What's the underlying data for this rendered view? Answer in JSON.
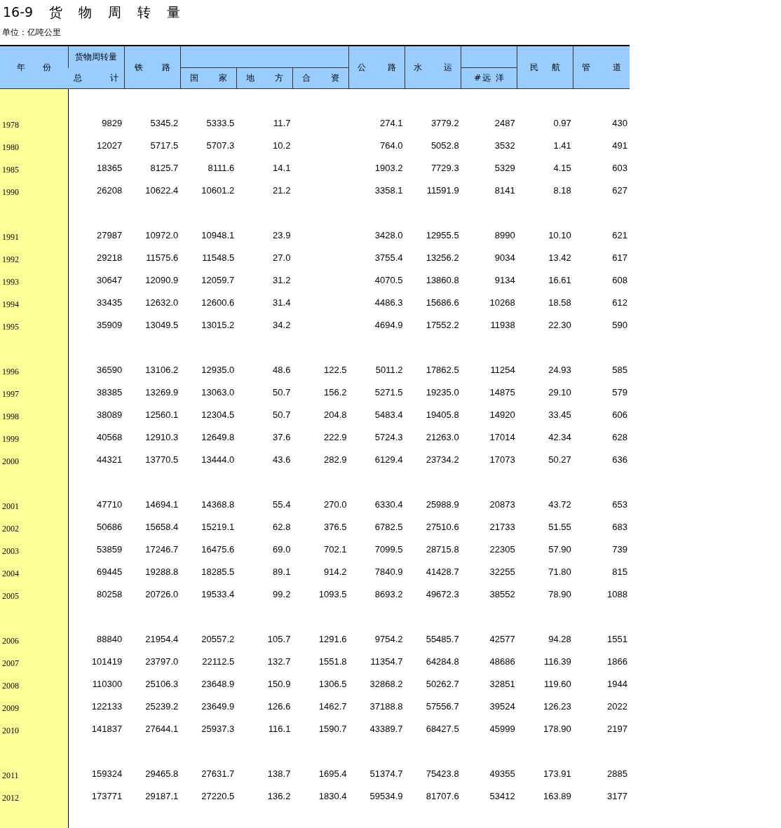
{
  "title": "16-9 货 物 周 转 量",
  "unit": "单位：亿吨公里",
  "header": {
    "year": "年 份",
    "total_top": "货物周转量",
    "total": "总 计",
    "rail": "铁 路",
    "national": "国 家",
    "local": "地 方",
    "joint": "合 资",
    "road": "公 路",
    "water": "水 运",
    "ocean": "#远 洋",
    "aviation": "民 航",
    "pipeline": "管 道"
  },
  "groups": [
    {
      "rows": [
        {
          "year": "1978",
          "total": "9829",
          "rail": "5345.2",
          "national": "5333.5",
          "local": "11.7",
          "road": "274.1",
          "water": "3779.2",
          "ocean": "2487",
          "aviation": "0.97",
          "pipeline": "430"
        },
        {
          "year": "1980",
          "total": "12027",
          "rail": "5717.5",
          "national": "5707.3",
          "local": "10.2",
          "road": "764.0",
          "water": "5052.8",
          "ocean": "3532",
          "aviation": "1.41",
          "pipeline": "491"
        },
        {
          "year": "1985",
          "total": "18365",
          "rail": "8125.7",
          "national": "8111.6",
          "local": "14.1",
          "road": "1903.2",
          "water": "7729.3",
          "ocean": "5329",
          "aviation": "4.15",
          "pipeline": "603"
        },
        {
          "year": "1990",
          "total": "26208",
          "rail": "10622.4",
          "national": "10601.2",
          "local": "21.2",
          "road": "3358.1",
          "water": "11591.9",
          "ocean": "8141",
          "aviation": "8.18",
          "pipeline": "627"
        }
      ]
    },
    {
      "rows": [
        {
          "year": "1991",
          "total": "27987",
          "rail": "10972.0",
          "national": "10948.1",
          "local": "23.9",
          "road": "3428.0",
          "water": "12955.5",
          "ocean": "8990",
          "aviation": "10.10",
          "pipeline": "621"
        },
        {
          "year": "1992",
          "total": "29218",
          "rail": "11575.6",
          "national": "11548.5",
          "local": "27.0",
          "road": "3755.4",
          "water": "13256.2",
          "ocean": "9034",
          "aviation": "13.42",
          "pipeline": "617"
        },
        {
          "year": "1993",
          "total": "30647",
          "rail": "12090.9",
          "national": "12059.7",
          "local": "31.2",
          "road": "4070.5",
          "water": "13860.8",
          "ocean": "9134",
          "aviation": "16.61",
          "pipeline": "608"
        },
        {
          "year": "1994",
          "total": "33435",
          "rail": "12632.0",
          "national": "12600.6",
          "local": "31.4",
          "road": "4486.3",
          "water": "15686.6",
          "ocean": "10268",
          "aviation": "18.58",
          "pipeline": "612"
        },
        {
          "year": "1995",
          "total": "35909",
          "rail": "13049.5",
          "national": "13015.2",
          "local": "34.2",
          "road": "4694.9",
          "water": "17552.2",
          "ocean": "11938",
          "aviation": "22.30",
          "pipeline": "590"
        }
      ]
    },
    {
      "rows": [
        {
          "year": "1996",
          "total": "36590",
          "rail": "13106.2",
          "national": "12935.0",
          "local": "48.6",
          "joint": "122.5",
          "road": "5011.2",
          "water": "17862.5",
          "ocean": "11254",
          "aviation": "24.93",
          "pipeline": "585"
        },
        {
          "year": "1997",
          "total": "38385",
          "rail": "13269.9",
          "national": "13063.0",
          "local": "50.7",
          "joint": "156.2",
          "road": "5271.5",
          "water": "19235.0",
          "ocean": "14875",
          "aviation": "29.10",
          "pipeline": "579"
        },
        {
          "year": "1998",
          "total": "38089",
          "rail": "12560.1",
          "national": "12304.5",
          "local": "50.7",
          "joint": "204.8",
          "road": "5483.4",
          "water": "19405.8",
          "ocean": "14920",
          "aviation": "33.45",
          "pipeline": "606"
        },
        {
          "year": "1999",
          "total": "40568",
          "rail": "12910.3",
          "national": "12649.8",
          "local": "37.6",
          "joint": "222.9",
          "road": "5724.3",
          "water": "21263.0",
          "ocean": "17014",
          "aviation": "42.34",
          "pipeline": "628"
        },
        {
          "year": "2000",
          "total": "44321",
          "rail": "13770.5",
          "national": "13444.0",
          "local": "43.6",
          "joint": "282.9",
          "road": "6129.4",
          "water": "23734.2",
          "ocean": "17073",
          "aviation": "50.27",
          "pipeline": "636"
        }
      ]
    },
    {
      "rows": [
        {
          "year": "2001",
          "total": "47710",
          "rail": "14694.1",
          "national": "14368.8",
          "local": "55.4",
          "joint": "270.0",
          "road": "6330.4",
          "water": "25988.9",
          "ocean": "20873",
          "aviation": "43.72",
          "pipeline": "653"
        },
        {
          "year": "2002",
          "total": "50686",
          "rail": "15658.4",
          "national": "15219.1",
          "local": "62.8",
          "joint": "376.5",
          "road": "6782.5",
          "water": "27510.6",
          "ocean": "21733",
          "aviation": "51.55",
          "pipeline": "683"
        },
        {
          "year": "2003",
          "total": "53859",
          "rail": "17246.7",
          "national": "16475.6",
          "local": "69.0",
          "joint": "702.1",
          "road": "7099.5",
          "water": "28715.8",
          "ocean": "22305",
          "aviation": "57.90",
          "pipeline": "739"
        },
        {
          "year": "2004",
          "total": "69445",
          "rail": "19288.8",
          "national": "18285.5",
          "local": "89.1",
          "joint": "914.2",
          "road": "7840.9",
          "water": "41428.7",
          "ocean": "32255",
          "aviation": "71.80",
          "pipeline": "815"
        },
        {
          "year": "2005",
          "total": "80258",
          "rail": "20726.0",
          "national": "19533.4",
          "local": "99.2",
          "joint": "1093.5",
          "road": "8693.2",
          "water": "49672.3",
          "ocean": "38552",
          "aviation": "78.90",
          "pipeline": "1088"
        }
      ]
    },
    {
      "rows": [
        {
          "year": "2006",
          "total": "88840",
          "rail": "21954.4",
          "national": "20557.2",
          "local": "105.7",
          "joint": "1291.6",
          "road": "9754.2",
          "water": "55485.7",
          "ocean": "42577",
          "aviation": "94.28",
          "pipeline": "1551"
        },
        {
          "year": "2007",
          "total": "101419",
          "rail": "23797.0",
          "national": "22112.5",
          "local": "132.7",
          "joint": "1551.8",
          "road": "11354.7",
          "water": "64284.8",
          "ocean": "48686",
          "aviation": "116.39",
          "pipeline": "1866"
        },
        {
          "year": "2008",
          "total": "110300",
          "rail": "25106.3",
          "national": "23648.9",
          "local": "150.9",
          "joint": "1306.5",
          "road": "32868.2",
          "water": "50262.7",
          "ocean": "32851",
          "aviation": "119.60",
          "pipeline": "1944"
        },
        {
          "year": "2009",
          "total": "122133",
          "rail": "25239.2",
          "national": "23649.9",
          "local": "126.6",
          "joint": "1462.7",
          "road": "37188.8",
          "water": "57556.7",
          "ocean": "39524",
          "aviation": "126.23",
          "pipeline": "2022"
        },
        {
          "year": "2010",
          "total": "141837",
          "rail": "27644.1",
          "national": "25937.3",
          "local": "116.1",
          "joint": "1590.7",
          "road": "43389.7",
          "water": "68427.5",
          "ocean": "45999",
          "aviation": "178.90",
          "pipeline": "2197"
        }
      ]
    },
    {
      "rows": [
        {
          "year": "2011",
          "total": "159324",
          "rail": "29465.8",
          "national": "27631.7",
          "local": "138.7",
          "joint": "1695.4",
          "road": "51374.7",
          "water": "75423.8",
          "ocean": "49355",
          "aviation": "173.91",
          "pipeline": "2885"
        },
        {
          "year": "2012",
          "total": "173771",
          "rail": "29187.1",
          "national": "27220.5",
          "local": "136.2",
          "joint": "1830.4",
          "road": "59534.9",
          "water": "81707.6",
          "ocean": "53412",
          "aviation": "163.89",
          "pipeline": "3177"
        }
      ]
    }
  ]
}
